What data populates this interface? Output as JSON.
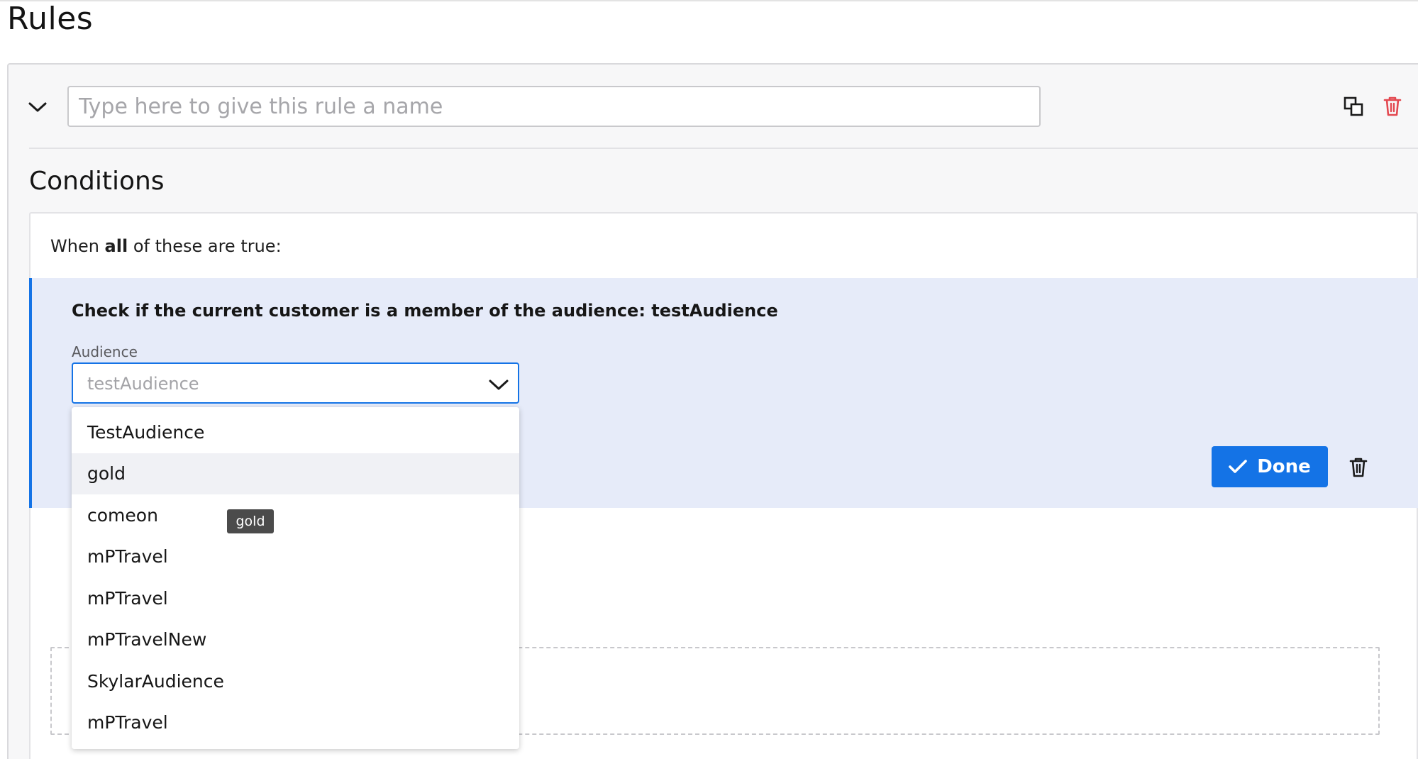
{
  "page": {
    "title": "Rules"
  },
  "rule": {
    "name_value": "",
    "name_placeholder": "Type here to give this rule a name",
    "conditions_heading": "Conditions",
    "when_prefix": "When ",
    "when_keyword": "all",
    "when_suffix": " of these are true:",
    "condition": {
      "title": "Check if the current customer is a member of the audience: testAudience",
      "audience_label": "Audience",
      "audience_value": "testAudience",
      "done_label": "Done"
    }
  },
  "dropdown": {
    "options": [
      {
        "label": "TestAudience"
      },
      {
        "label": "gold",
        "hovered": true
      },
      {
        "label": "comeon"
      },
      {
        "label": "mPTravel"
      },
      {
        "label": "mPTravel"
      },
      {
        "label": "mPTravelNew"
      },
      {
        "label": "SkylarAudience"
      },
      {
        "label": "mPTravel"
      }
    ]
  },
  "tooltip": {
    "text": "gold"
  },
  "icons": {
    "collapse": "chevron-down-icon",
    "copy": "copy-icon",
    "delete_rule": "trash-icon",
    "audience_picker": "chevron-down-icon",
    "done": "checkmark-icon",
    "delete_condition": "trash-icon"
  },
  "colors": {
    "accent": "#1473e6",
    "danger": "#e34850",
    "panel_highlight": "#e6ebf9",
    "tooltip_bg": "#4b4b4b"
  }
}
